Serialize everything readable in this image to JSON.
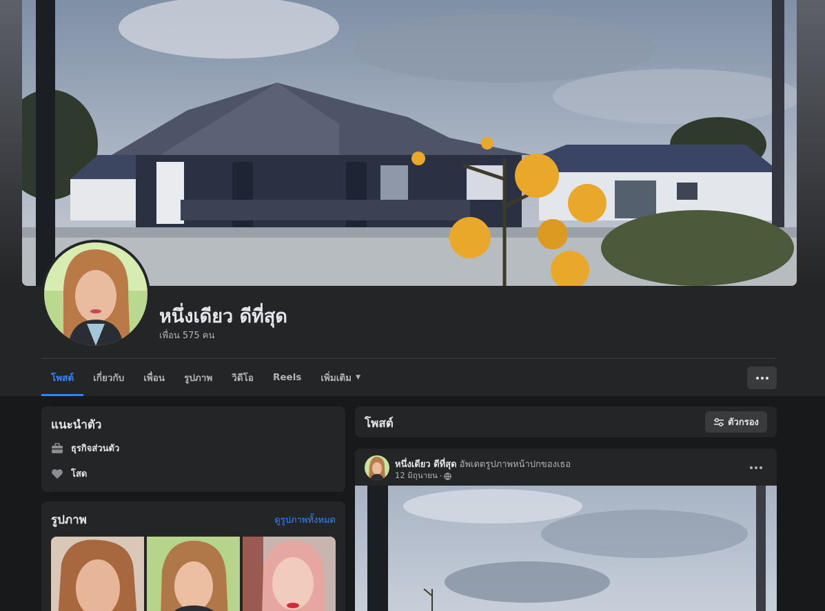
{
  "profile": {
    "name": "หนึ่งเดียว ดีที่สุด",
    "friends_text": "เพื่อน 575 คน"
  },
  "tabs": [
    {
      "label": "โพสต์",
      "active": true
    },
    {
      "label": "เกี่ยวกับ",
      "active": false
    },
    {
      "label": "เพื่อน",
      "active": false
    },
    {
      "label": "รูปภาพ",
      "active": false
    },
    {
      "label": "วิดีโอ",
      "active": false
    },
    {
      "label": "Reels",
      "active": false
    },
    {
      "label": "เพิ่มเติม",
      "active": false
    }
  ],
  "intro": {
    "title": "แนะนำตัว",
    "work": "ธุรกิจส่วนตัว",
    "relationship": "โสด"
  },
  "photos": {
    "title": "รูปภาพ",
    "see_all": "ดูรูปภาพทั้งหมด"
  },
  "posts": {
    "title": "โพสต์",
    "filter_label": "ตัวกรอง"
  },
  "post": {
    "author": "หนึ่งเดียว ดีที่สุด",
    "action": "อัพเดตรูปภาพหน้าปกของเธอ",
    "date": "12 มิถุนายน",
    "date_separator": "·"
  },
  "icons": {
    "more": "more-dots-icon",
    "briefcase": "briefcase-icon",
    "heart": "heart-icon",
    "filter": "filter-sliders-icon",
    "globe": "globe-icon",
    "caret": "caret-down-icon"
  },
  "colors": {
    "accent": "#2d88ff",
    "surface": "#242526",
    "background": "#18191a",
    "button": "#3a3b3c",
    "text_primary": "#e4e6eb",
    "text_secondary": "#b0b3b8"
  }
}
